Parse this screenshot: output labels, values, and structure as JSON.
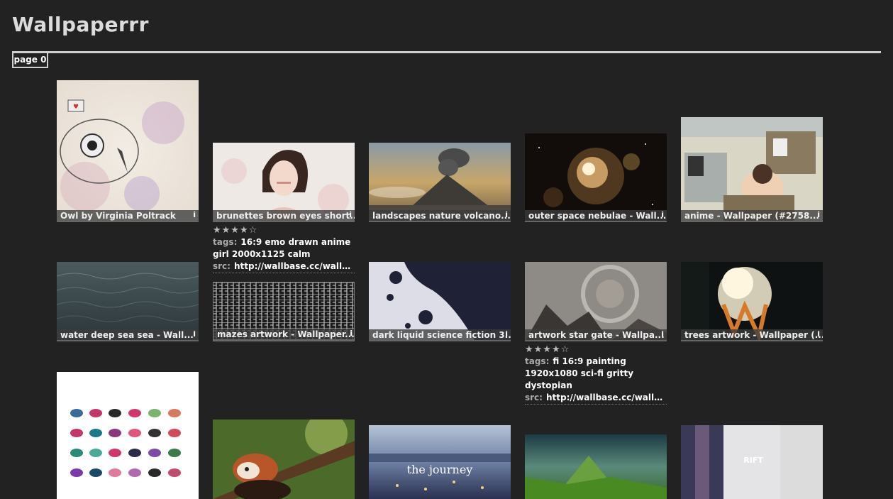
{
  "app": {
    "title": "Wallpaperrr"
  },
  "pagination": {
    "current_label": "page 0"
  },
  "cards": [
    {
      "caption": "Owl by Virginia Poltrack",
      "info": "i"
    },
    {
      "caption": "brunettes brown eyes short...",
      "info": "i"
    },
    {
      "caption": "landscapes nature volcano...",
      "info": "i"
    },
    {
      "caption": "outer space nebulae - Wall...",
      "info": "i"
    },
    {
      "caption": "anime - Wallpaper (#2758...",
      "info": "i"
    },
    {
      "caption": "water deep sea sea - Wall...",
      "info": "i"
    },
    {
      "caption": "mazes artwork - Wallpaper...",
      "info": "i"
    },
    {
      "caption": "dark liquid science fiction 3...",
      "info": "i"
    },
    {
      "caption": "artwork star gate - Wallpa...",
      "info": "i"
    },
    {
      "caption": "trees artwork - Wallpaper (...",
      "info": "i"
    },
    {
      "caption": "",
      "info": ""
    },
    {
      "caption": "",
      "info": ""
    },
    {
      "caption": "",
      "info": "",
      "overlay_text": "the journey"
    },
    {
      "caption": "",
      "info": ""
    },
    {
      "caption": "",
      "info": "",
      "overlay_text": "RIFT"
    }
  ],
  "details": [
    {
      "rating": 4,
      "stars": "★★★★☆",
      "tags_label": "tags:",
      "tags": "16:9 emo drawn anime girl 2000x1125 calm",
      "src_label": "src:",
      "src": "http://wallbase.cc/wallpa..."
    },
    {
      "rating": 4,
      "stars": "★★★★☆",
      "tags_label": "tags:",
      "tags": "fi 16:9 painting 1920x1080 sci-fi gritty dystopian",
      "src_label": "src:",
      "src": "http://wallbase.cc/wallpa..."
    }
  ]
}
